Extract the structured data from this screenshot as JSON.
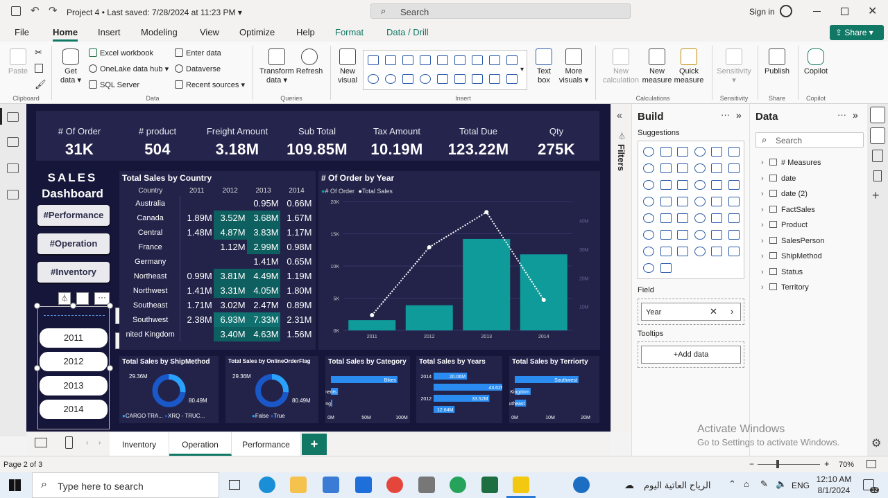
{
  "title": {
    "project": "Project 4",
    "saved": "Last saved: 7/28/2024 at 11:23 PM",
    "search": "Search",
    "signin": "Sign in"
  },
  "tabs": [
    "File",
    "Home",
    "Insert",
    "Modeling",
    "View",
    "Optimize",
    "Help",
    "Format",
    "Data / Drill"
  ],
  "share": "Share",
  "ribbon": {
    "paste": "Paste",
    "clipboard": "Clipboard",
    "getdata": "Get",
    "getdata2": "data",
    "excel": "Excel workbook",
    "onelake": "OneLake data hub",
    "sql": "SQL Server",
    "enterdata": "Enter data",
    "dataverse": "Dataverse",
    "recent": "Recent sources",
    "data": "Data",
    "transform": "Transform",
    "transform2": "data",
    "refresh": "Refresh",
    "queries": "Queries",
    "newvisual": "New",
    "newvisual2": "visual",
    "textbox": "Text",
    "textbox2": "box",
    "morevisuals": "More",
    "morevisuals2": "visuals",
    "insert": "Insert",
    "newcalc": "New",
    "newcalc2": "calculation",
    "newmeasure": "New",
    "newmeasure2": "measure",
    "quick": "Quick",
    "quick2": "measure",
    "calculations": "Calculations",
    "sensitivity": "Sensitivity",
    "sensitivitygrp": "Sensitivity",
    "publish": "Publish",
    "sharegrp": "Share",
    "copilot": "Copilot",
    "copilotgrp": "Copilot"
  },
  "kpis": [
    {
      "label": "# Of Order",
      "value": "31K"
    },
    {
      "label": "# product",
      "value": "504"
    },
    {
      "label": "Freight Amount",
      "value": "3.18M"
    },
    {
      "label": "Sub Total",
      "value": "109.85M"
    },
    {
      "label": "Tax Amount",
      "value": "10.19M"
    },
    {
      "label": "Total Due",
      "value": "123.22M"
    },
    {
      "label": "Qty",
      "value": "275K"
    }
  ],
  "dash": {
    "sales": "SALES",
    "dashboard": "Dashboard",
    "b1": "#Performance",
    "b2": "#Operation",
    "b3": "#Inventory",
    "years": [
      "2011",
      "2012",
      "2013",
      "2014"
    ]
  },
  "matrix": {
    "title": "Total Sales by Country",
    "headers": [
      "Country",
      "2011",
      "2012",
      "2013",
      "2014"
    ],
    "rows": [
      [
        "Australia",
        "",
        "",
        "0.95M",
        "0.66M"
      ],
      [
        "Canada",
        "1.89M",
        "3.52M",
        "3.68M",
        "1.67M"
      ],
      [
        "Central",
        "1.48M",
        "4.87M",
        "3.83M",
        "1.17M"
      ],
      [
        "France",
        "",
        "1.12M",
        "2.99M",
        "0.98M"
      ],
      [
        "Germany",
        "",
        "",
        "1.41M",
        "0.65M"
      ],
      [
        "Northeast",
        "0.99M",
        "3.81M",
        "4.49M",
        "1.19M"
      ],
      [
        "Northwest",
        "1.41M",
        "3.31M",
        "4.05M",
        "1.80M"
      ],
      [
        "Southeast",
        "1.71M",
        "3.02M",
        "2.47M",
        "0.89M"
      ],
      [
        "Southwest",
        "2.38M",
        "6.93M",
        "7.33M",
        "2.31M"
      ],
      [
        "nited Kingdom",
        "",
        "3.40M",
        "4.63M",
        "1.56M"
      ]
    ]
  },
  "chart_data": [
    {
      "type": "bar",
      "title": "# Of Order by Year",
      "legend": [
        "# Of Order",
        "Total Sales"
      ],
      "categories": [
        "2011",
        "2012",
        "2013",
        "2014"
      ],
      "series": [
        {
          "name": "# Of Order",
          "values": [
            1600,
            3900,
            14200,
            11800
          ]
        },
        {
          "name": "Total Sales",
          "values": [
            6.5,
            35.5,
            50.5,
            13
          ]
        }
      ],
      "yticks": [
        "20K",
        "15K",
        "10K",
        "5K",
        "0K"
      ],
      "y2ticks": [
        "40M",
        "30M",
        "20M",
        "10M"
      ],
      "ylim": [
        0,
        20000
      ],
      "y2lim": [
        0,
        55
      ]
    },
    {
      "type": "pie",
      "title": "Total Sales by ShipMethod",
      "labels": [
        "29.36M",
        "80.49M"
      ],
      "legend": [
        "CARGO TRA...",
        "XRQ - TRUC..."
      ],
      "values": [
        29.36,
        80.49
      ]
    },
    {
      "type": "pie",
      "title": "Total Sales by OnlineOrderFlag",
      "labels": [
        "29.36M",
        "80.49M"
      ],
      "legend": [
        "False",
        "True"
      ],
      "values": [
        29.36,
        80.49
      ]
    },
    {
      "type": "bar",
      "title": "Total Sales by Category",
      "categories": [
        "Bikes",
        "Components",
        "Clothing"
      ],
      "values": [
        94,
        10,
        2
      ],
      "xticks": [
        "0M",
        "50M",
        "100M"
      ],
      "xlim": [
        0,
        100
      ]
    },
    {
      "type": "bar",
      "title": "Total Sales by Years",
      "categories": [
        "2014",
        "",
        "2012",
        ""
      ],
      "labels": [
        "20.06M",
        "43.62M",
        "33.52M",
        "12.64M"
      ],
      "values": [
        20.06,
        43.62,
        33.52,
        12.64
      ],
      "xlim": [
        0,
        50
      ]
    },
    {
      "type": "bar",
      "title": "Total Sales by Terriorty",
      "categories": [
        "Southwest",
        "United Kingdom",
        "Southeast"
      ],
      "values": [
        18,
        4.5,
        3.2
      ],
      "xticks": [
        "0M",
        "10M",
        "20M"
      ],
      "xlim": [
        0,
        20
      ]
    }
  ],
  "build": {
    "title": "Build",
    "suggestions": "Suggestions",
    "field": "Field",
    "fieldval": "Year",
    "tooltips": "Tooltips",
    "adddata": "+Add data"
  },
  "datapane": {
    "title": "Data",
    "search": "Search",
    "items": [
      "# Measures",
      "date",
      "date (2)",
      "FactSales",
      "Product",
      "SalesPerson",
      "ShipMethod",
      "Status",
      "Territory"
    ]
  },
  "filters": "Filters",
  "pages": [
    "Inventory",
    "Operation",
    "Performance"
  ],
  "status": {
    "page": "Page 2 of 3",
    "zoom": "70%"
  },
  "activate": {
    "l1": "Activate Windows",
    "l2": "Go to Settings to activate Windows."
  },
  "taskbar": {
    "search": "Type here to search",
    "news": "الرياح العاتية اليوم",
    "lang": "ENG",
    "time": "12:10 AM",
    "date": "8/1/2024",
    "notif": "12"
  }
}
